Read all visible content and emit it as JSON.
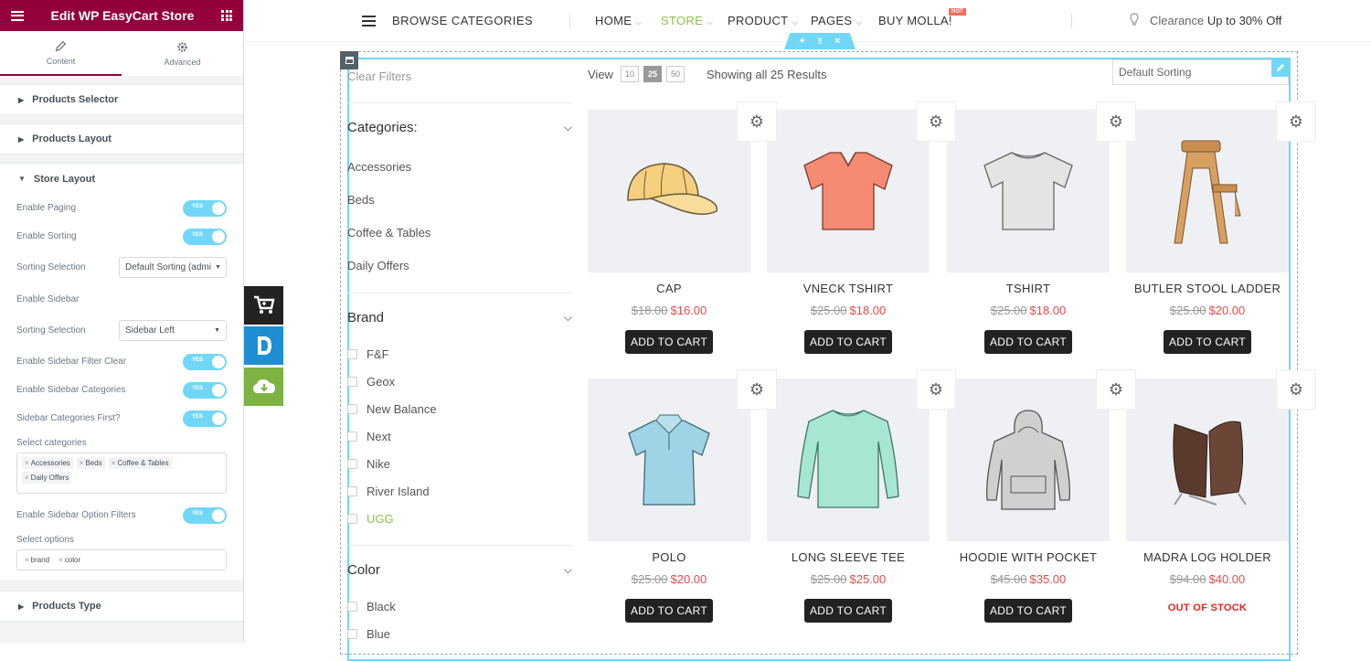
{
  "panel": {
    "title": "Edit WP EasyCart Store",
    "tabs": [
      {
        "label": "Content"
      },
      {
        "label": "Advanced"
      }
    ],
    "sections": {
      "products_selector": "Products Selector",
      "products_layout": "Products Layout",
      "store_layout": "Store Layout",
      "products_type": "Products Type"
    },
    "toggle_yes": "YES",
    "controls": {
      "enable_paging": "Enable Paging",
      "enable_sorting": "Enable Sorting",
      "sorting_selection": "Sorting Selection",
      "sorting_selection_value": "Default Sorting (admi",
      "enable_sidebar": "Enable Sidebar",
      "sidebar_position_label": "Sorting Selection",
      "sidebar_position_value": "Sidebar Left",
      "enable_sidebar_filter_clear": "Enable Sidebar Filter Clear",
      "enable_sidebar_categories": "Enable Sidebar Categories",
      "sidebar_categories_first": "Sidebar Categories First?",
      "select_categories": "Select categories",
      "categories_chips": [
        "Accessories",
        "Beds",
        "Coffee & Tables",
        "Daily Offers"
      ],
      "enable_sidebar_option_filters": "Enable Sidebar Option Filters",
      "select_options": "Select options",
      "options_chips": [
        "brand",
        "color"
      ]
    }
  },
  "nav": {
    "browse": "BROWSE CATEGORIES",
    "items": [
      {
        "label": "HOME"
      },
      {
        "label": "STORE"
      },
      {
        "label": "PRODUCT"
      },
      {
        "label": "PAGES"
      },
      {
        "label": "BUY MOLLA!"
      }
    ],
    "hot_badge": "HOT",
    "clearance_prefix": "Clearance",
    "clearance_strong": "Up to 30% Off"
  },
  "colors": {
    "panel_brand": "#93003c",
    "toggle_on": "#71d7f7",
    "active_green": "#8bc34a",
    "sale_red": "#e84b4b"
  },
  "store": {
    "clear_filters": "Clear Filters",
    "view_label": "View",
    "view_options": [
      "10",
      "25",
      "50"
    ],
    "showing": "Showing all 25 Results",
    "sort": "Default Sorting",
    "categories_title": "Categories:",
    "categories": [
      "Accessories",
      "Beds",
      "Coffee & Tables",
      "Daily Offers"
    ],
    "brand_title": "Brand",
    "brands": [
      "F&F",
      "Geox",
      "New Balance",
      "Next",
      "Nike",
      "River Island",
      "UGG"
    ],
    "color_title": "Color",
    "colors": [
      "Black",
      "Blue"
    ],
    "add_to_cart": "ADD TO CART",
    "out_of_stock": "OUT OF STOCK",
    "products": [
      {
        "name": "CAP",
        "old": "$18.00",
        "new": "$16.00"
      },
      {
        "name": "VNECK TSHIRT",
        "old": "$25.00",
        "new": "$18.00"
      },
      {
        "name": "TSHIRT",
        "old": "$25.00",
        "new": "$18.00"
      },
      {
        "name": "BUTLER STOOL LADDER",
        "old": "$25.00",
        "new": "$20.00"
      },
      {
        "name": "POLO",
        "old": "$25.00",
        "new": "$20.00"
      },
      {
        "name": "LONG SLEEVE TEE",
        "old": "$25.00",
        "new": "$25.00"
      },
      {
        "name": "HOODIE WITH POCKET",
        "old": "$45.00",
        "new": "$35.00"
      },
      {
        "name": "MADRA LOG HOLDER",
        "old": "$94.00",
        "new": "$40.00"
      }
    ]
  }
}
